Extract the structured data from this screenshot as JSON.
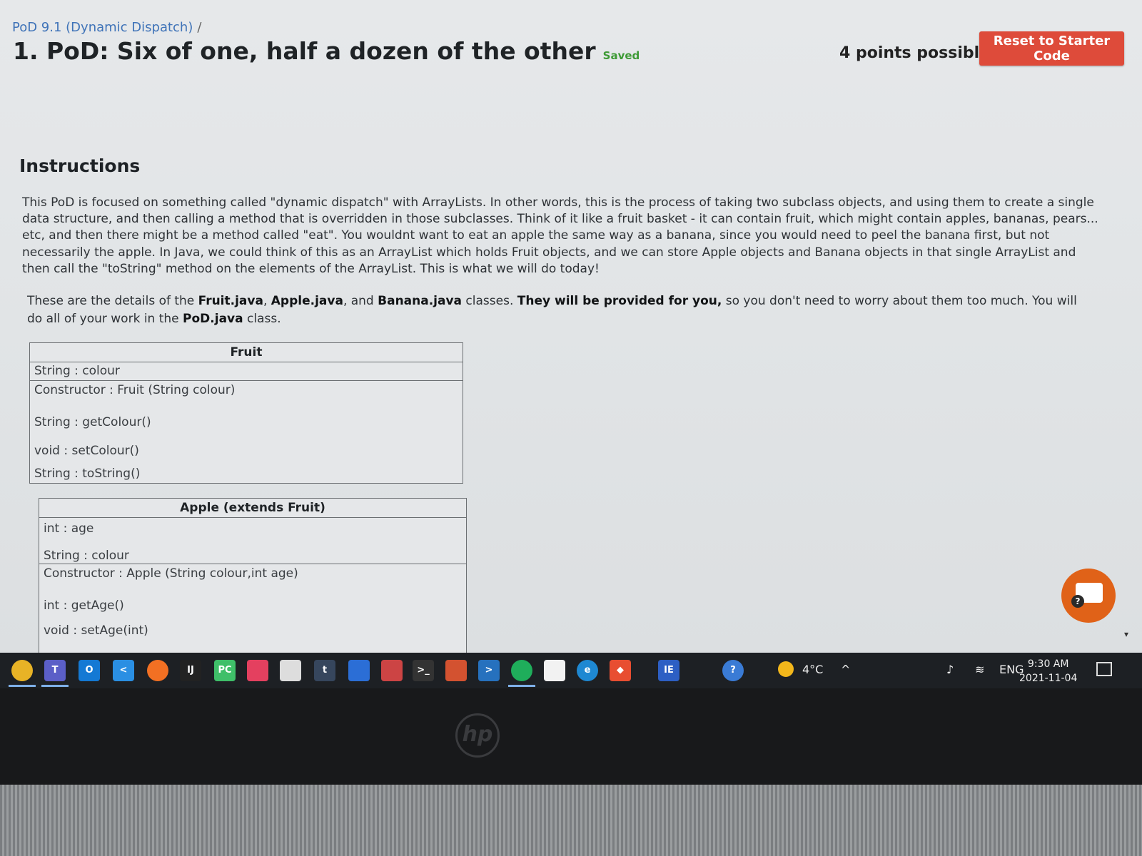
{
  "breadcrumb": {
    "link": "PoD 9.1 (Dynamic Dispatch)",
    "separator": "/"
  },
  "header": {
    "title": "1. PoD: Six of one, half a dozen of the other",
    "saved": "Saved",
    "points": "4 points possible",
    "reset_label": "Reset to Starter Code"
  },
  "instructions": {
    "heading": "Instructions",
    "paragraph1": "This PoD is focused on something called \"dynamic dispatch\" with ArrayLists. In other words, this is the process of taking two subclass objects, and using them to create a single data structure, and then calling a method that is overridden in those subclasses. Think of it like a fruit basket - it can contain fruit, which might contain apples, bananas, pears... etc, and then there might be a method called \"eat\". You wouldnt want to eat an apple the same way as a banana, since you would need to peel the banana first, but not necessarily the apple. In Java, we could think of this as an ArrayList which holds Fruit objects, and we can store Apple objects and Banana objects in that single ArrayList and then call the \"toString\" method on the elements of the ArrayList. This is what we will do today!",
    "p2_a": "These are the details of the ",
    "p2_fruit": "Fruit.java",
    "p2_b": ", ",
    "p2_apple": "Apple.java",
    "p2_c": ", and ",
    "p2_banana": "Banana.java",
    "p2_d": " classes. ",
    "p2_provided": "They will be provided for you,",
    "p2_e": " so you don't need to worry about them too much. You will do all of your work in the ",
    "p2_pod": "PoD.java",
    "p2_f": " class."
  },
  "fruit_table": {
    "header": "Fruit",
    "field": "String : colour",
    "constructor": "Constructor : Fruit (String colour)",
    "method1": "String : getColour()",
    "method2": "void : setColour()",
    "method3": "String : toString()"
  },
  "apple_table": {
    "header": "Apple (extends Fruit)",
    "field1": "int : age",
    "field2": "String : colour",
    "constructor": "Constructor : Apple (String colour,int age)",
    "method1": "int : getAge()",
    "method2": "void : setAge(int)"
  },
  "taskbar": {
    "apps": [
      {
        "icon": "chrome-icon",
        "color": "#e8b326",
        "label": ""
      },
      {
        "icon": "teams-icon",
        "color": "#5b5fc7",
        "label": "T"
      },
      {
        "icon": "outlook-icon",
        "color": "#1479d4",
        "label": "O"
      },
      {
        "icon": "vscode-icon",
        "color": "#2a8fe3",
        "label": "<"
      },
      {
        "icon": "firefox-icon",
        "color": "#f27023",
        "label": ""
      },
      {
        "icon": "intellij-icon",
        "color": "#222",
        "label": "IJ"
      },
      {
        "icon": "pycharm-icon",
        "color": "#3fbf69",
        "label": "PC"
      },
      {
        "icon": "creative-cloud-icon",
        "color": "#e4405f",
        "label": ""
      },
      {
        "icon": "popcorn-icon",
        "color": "#ddd",
        "label": ""
      },
      {
        "icon": "tumblr-icon",
        "color": "#36465d",
        "label": "t"
      },
      {
        "icon": "network-icon",
        "color": "#2b6ed6",
        "label": ""
      },
      {
        "icon": "snip-icon",
        "color": "#c44",
        "label": ""
      },
      {
        "icon": "terminal-icon",
        "color": "#333",
        "label": ">_"
      },
      {
        "icon": "powerpoint-icon",
        "color": "#d35230",
        "label": ""
      },
      {
        "icon": "powershell-icon",
        "color": "#2671be",
        "label": ">"
      },
      {
        "icon": "pinwheel-icon",
        "color": "#1fae5b",
        "label": ""
      },
      {
        "icon": "notepad-icon",
        "color": "#f2f2f2",
        "label": ""
      },
      {
        "icon": "edge-icon",
        "color": "#1e88d2",
        "label": "e"
      },
      {
        "icon": "git-icon",
        "color": "#e84e31",
        "label": "◆"
      },
      {
        "icon": "ie-icon",
        "color": "#2d5fc4",
        "label": "IE"
      },
      {
        "icon": "help-icon",
        "color": "#3a7bd5",
        "label": "?"
      }
    ],
    "weather": "4°C",
    "language": "ENG",
    "time": "9:30 AM",
    "date": "2021-11-04"
  },
  "colors": {
    "accent": "#de4b3a",
    "link": "#3f73b8",
    "saved": "#3d9a35",
    "chat": "#e06218"
  }
}
